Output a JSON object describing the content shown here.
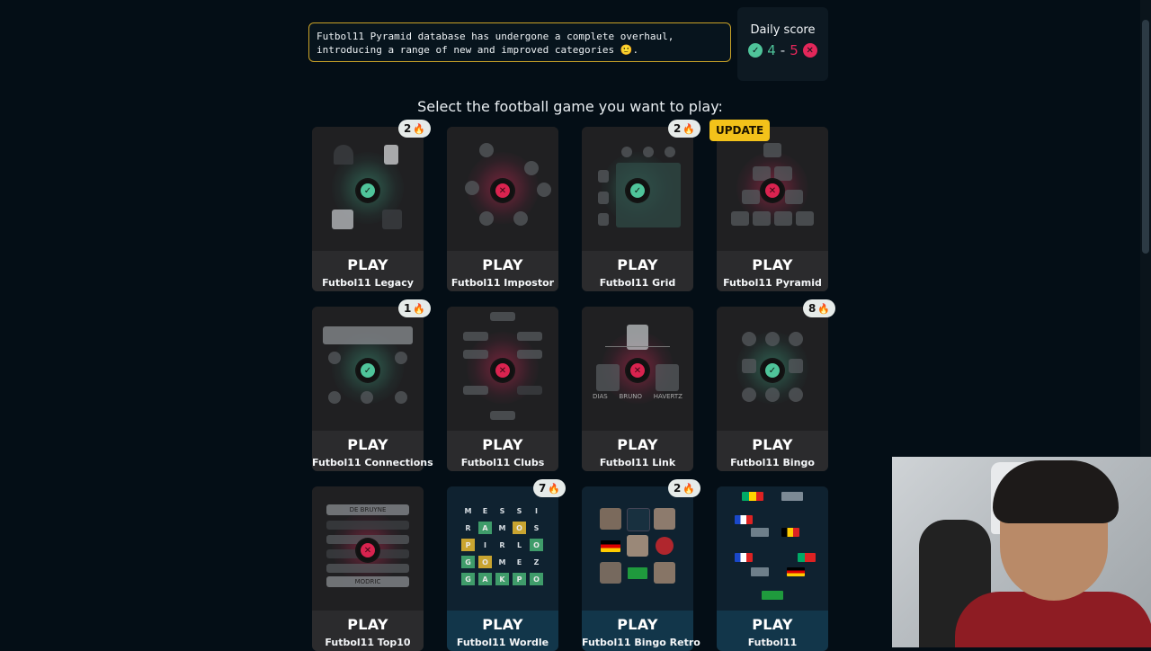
{
  "notice": {
    "text": "Futbol11 Pyramid database has undergone a complete overhaul, introducing a range of new and improved categories 🙂."
  },
  "daily_score": {
    "title": "Daily score",
    "correct": "4",
    "separator": "-",
    "wrong": "5"
  },
  "prompt": "Select the football game you want to play:",
  "play_label": "PLAY",
  "streak_icon": "fire-icon",
  "games": [
    {
      "name": "Futbol11 Legacy",
      "status": "ok",
      "streak": "2"
    },
    {
      "name": "Futbol11 Impostor",
      "status": "bad"
    },
    {
      "name": "Futbol11 Grid",
      "status": "ok",
      "streak": "2"
    },
    {
      "name": "Futbol11 Pyramid",
      "status": "bad",
      "badge": "UPDATE"
    },
    {
      "name": "Futbol11 Connections",
      "status": "ok",
      "streak": "1"
    },
    {
      "name": "Futbol11 Clubs",
      "status": "bad"
    },
    {
      "name": "Futbol11 Link",
      "status": "bad"
    },
    {
      "name": "Futbol11 Bingo",
      "status": "ok",
      "streak": "8"
    },
    {
      "name": "Futbol11 Top10",
      "status": "bad"
    },
    {
      "name": "Futbol11 Wordle",
      "streak": "7"
    },
    {
      "name": "Futbol11 Bingo Retro",
      "streak": "2"
    },
    {
      "name": "Futbol11"
    }
  ],
  "top10_thumb": {
    "row1": "DE BRUYNE",
    "row5": "MODRIC"
  },
  "link_thumb": {
    "names": [
      "DIAS",
      "BRUNO",
      "HAVERTZ"
    ]
  },
  "wordle_thumb": {
    "rows": [
      [
        "M",
        "E",
        "S",
        "S",
        "I"
      ],
      [
        "R",
        "A",
        "M",
        "O",
        "S"
      ],
      [
        "P",
        "I",
        "R",
        "L",
        "O"
      ],
      [
        "G",
        "O",
        "M",
        "E",
        "Z"
      ],
      [
        "G",
        "A",
        "K",
        "P",
        "O"
      ]
    ]
  },
  "colors": {
    "accent_gold": "#c9a227",
    "ok": "#4fc49a",
    "bad": "#e3275a",
    "update": "#f3c21a"
  }
}
